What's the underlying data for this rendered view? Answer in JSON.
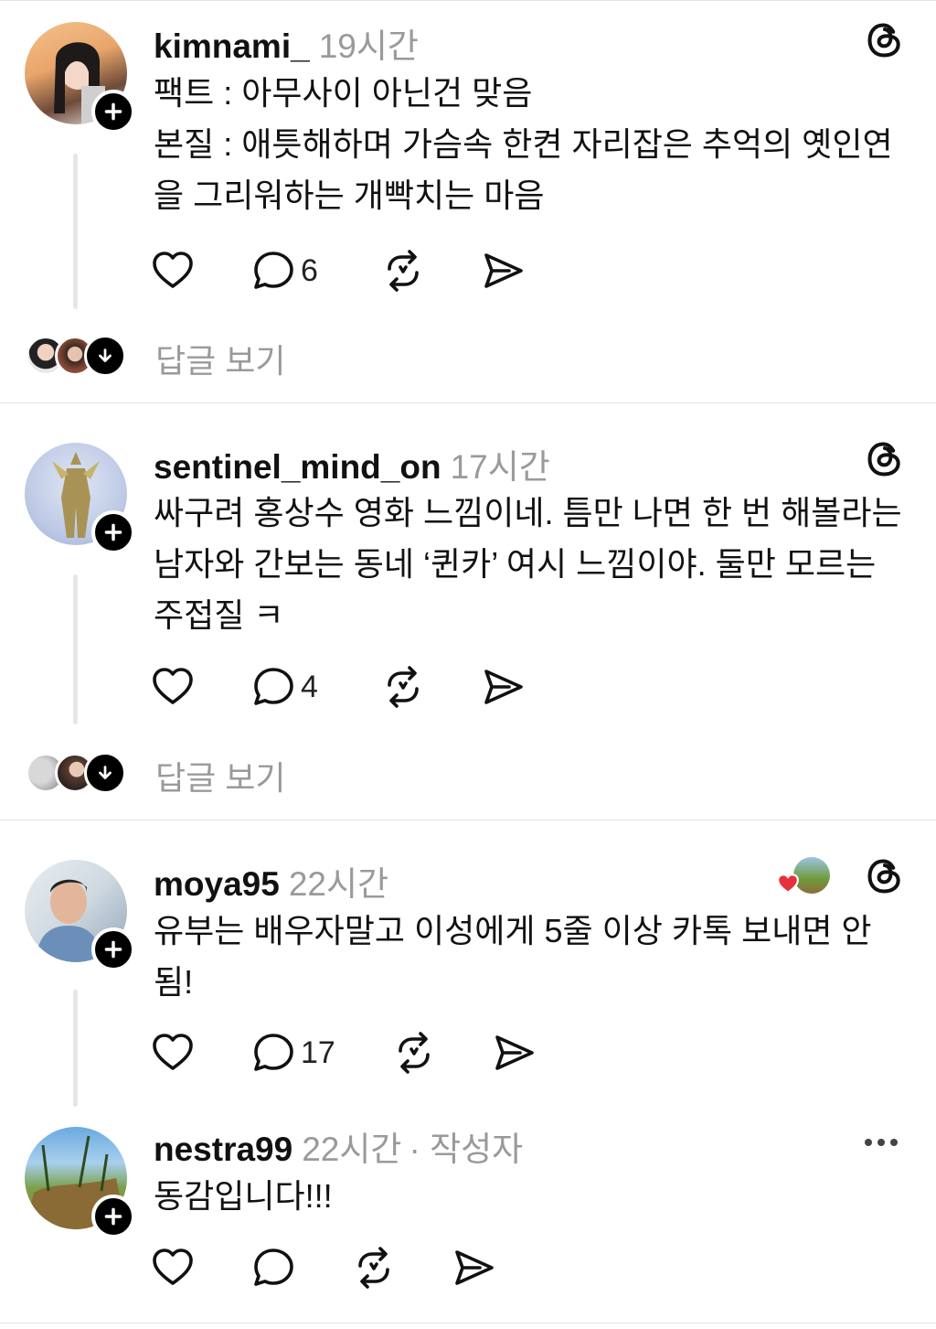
{
  "posts": [
    {
      "username": "kimnami_",
      "time": "19시간",
      "text": "팩트 : 아무사이 아닌건 맞음\n본질 : 애틋해하며 가슴속 한켠 자리잡은 추억의 옛인연을 그리워하는 개빡치는 마음",
      "replies": "6",
      "view_replies": "답글 보기"
    },
    {
      "username": "sentinel_mind_on",
      "time": "17시간",
      "text": "싸구려 홍상수 영화 느낌이네. 틈만 나면 한 번 해볼라는 남자와 간보는 동네 ‘퀸카’ 여시 느낌이야. 둘만 모르는 주접질 ㅋ",
      "replies": "4",
      "view_replies": "답글 보기"
    },
    {
      "username": "moya95",
      "time": "22시간",
      "text": "유부는 배우자말고 이성에게 5줄 이상 카톡 보내면 안됨!",
      "replies": "17"
    },
    {
      "username": "nestra99",
      "time": "22시간",
      "author_tag": "· 작성자",
      "text": "동감입니다!!!",
      "replies": ""
    }
  ],
  "icons": {
    "like": "heart-icon",
    "reply": "comment-icon",
    "repost": "repost-icon",
    "share": "send-icon",
    "app": "threads-logo-icon",
    "follow": "plus-icon",
    "expand": "arrow-down-icon",
    "more": "more-dots-icon"
  },
  "colors": {
    "text": "#111111",
    "muted": "#9a9a9a",
    "divider": "#e3e3e3",
    "heart": "#e8303f"
  }
}
